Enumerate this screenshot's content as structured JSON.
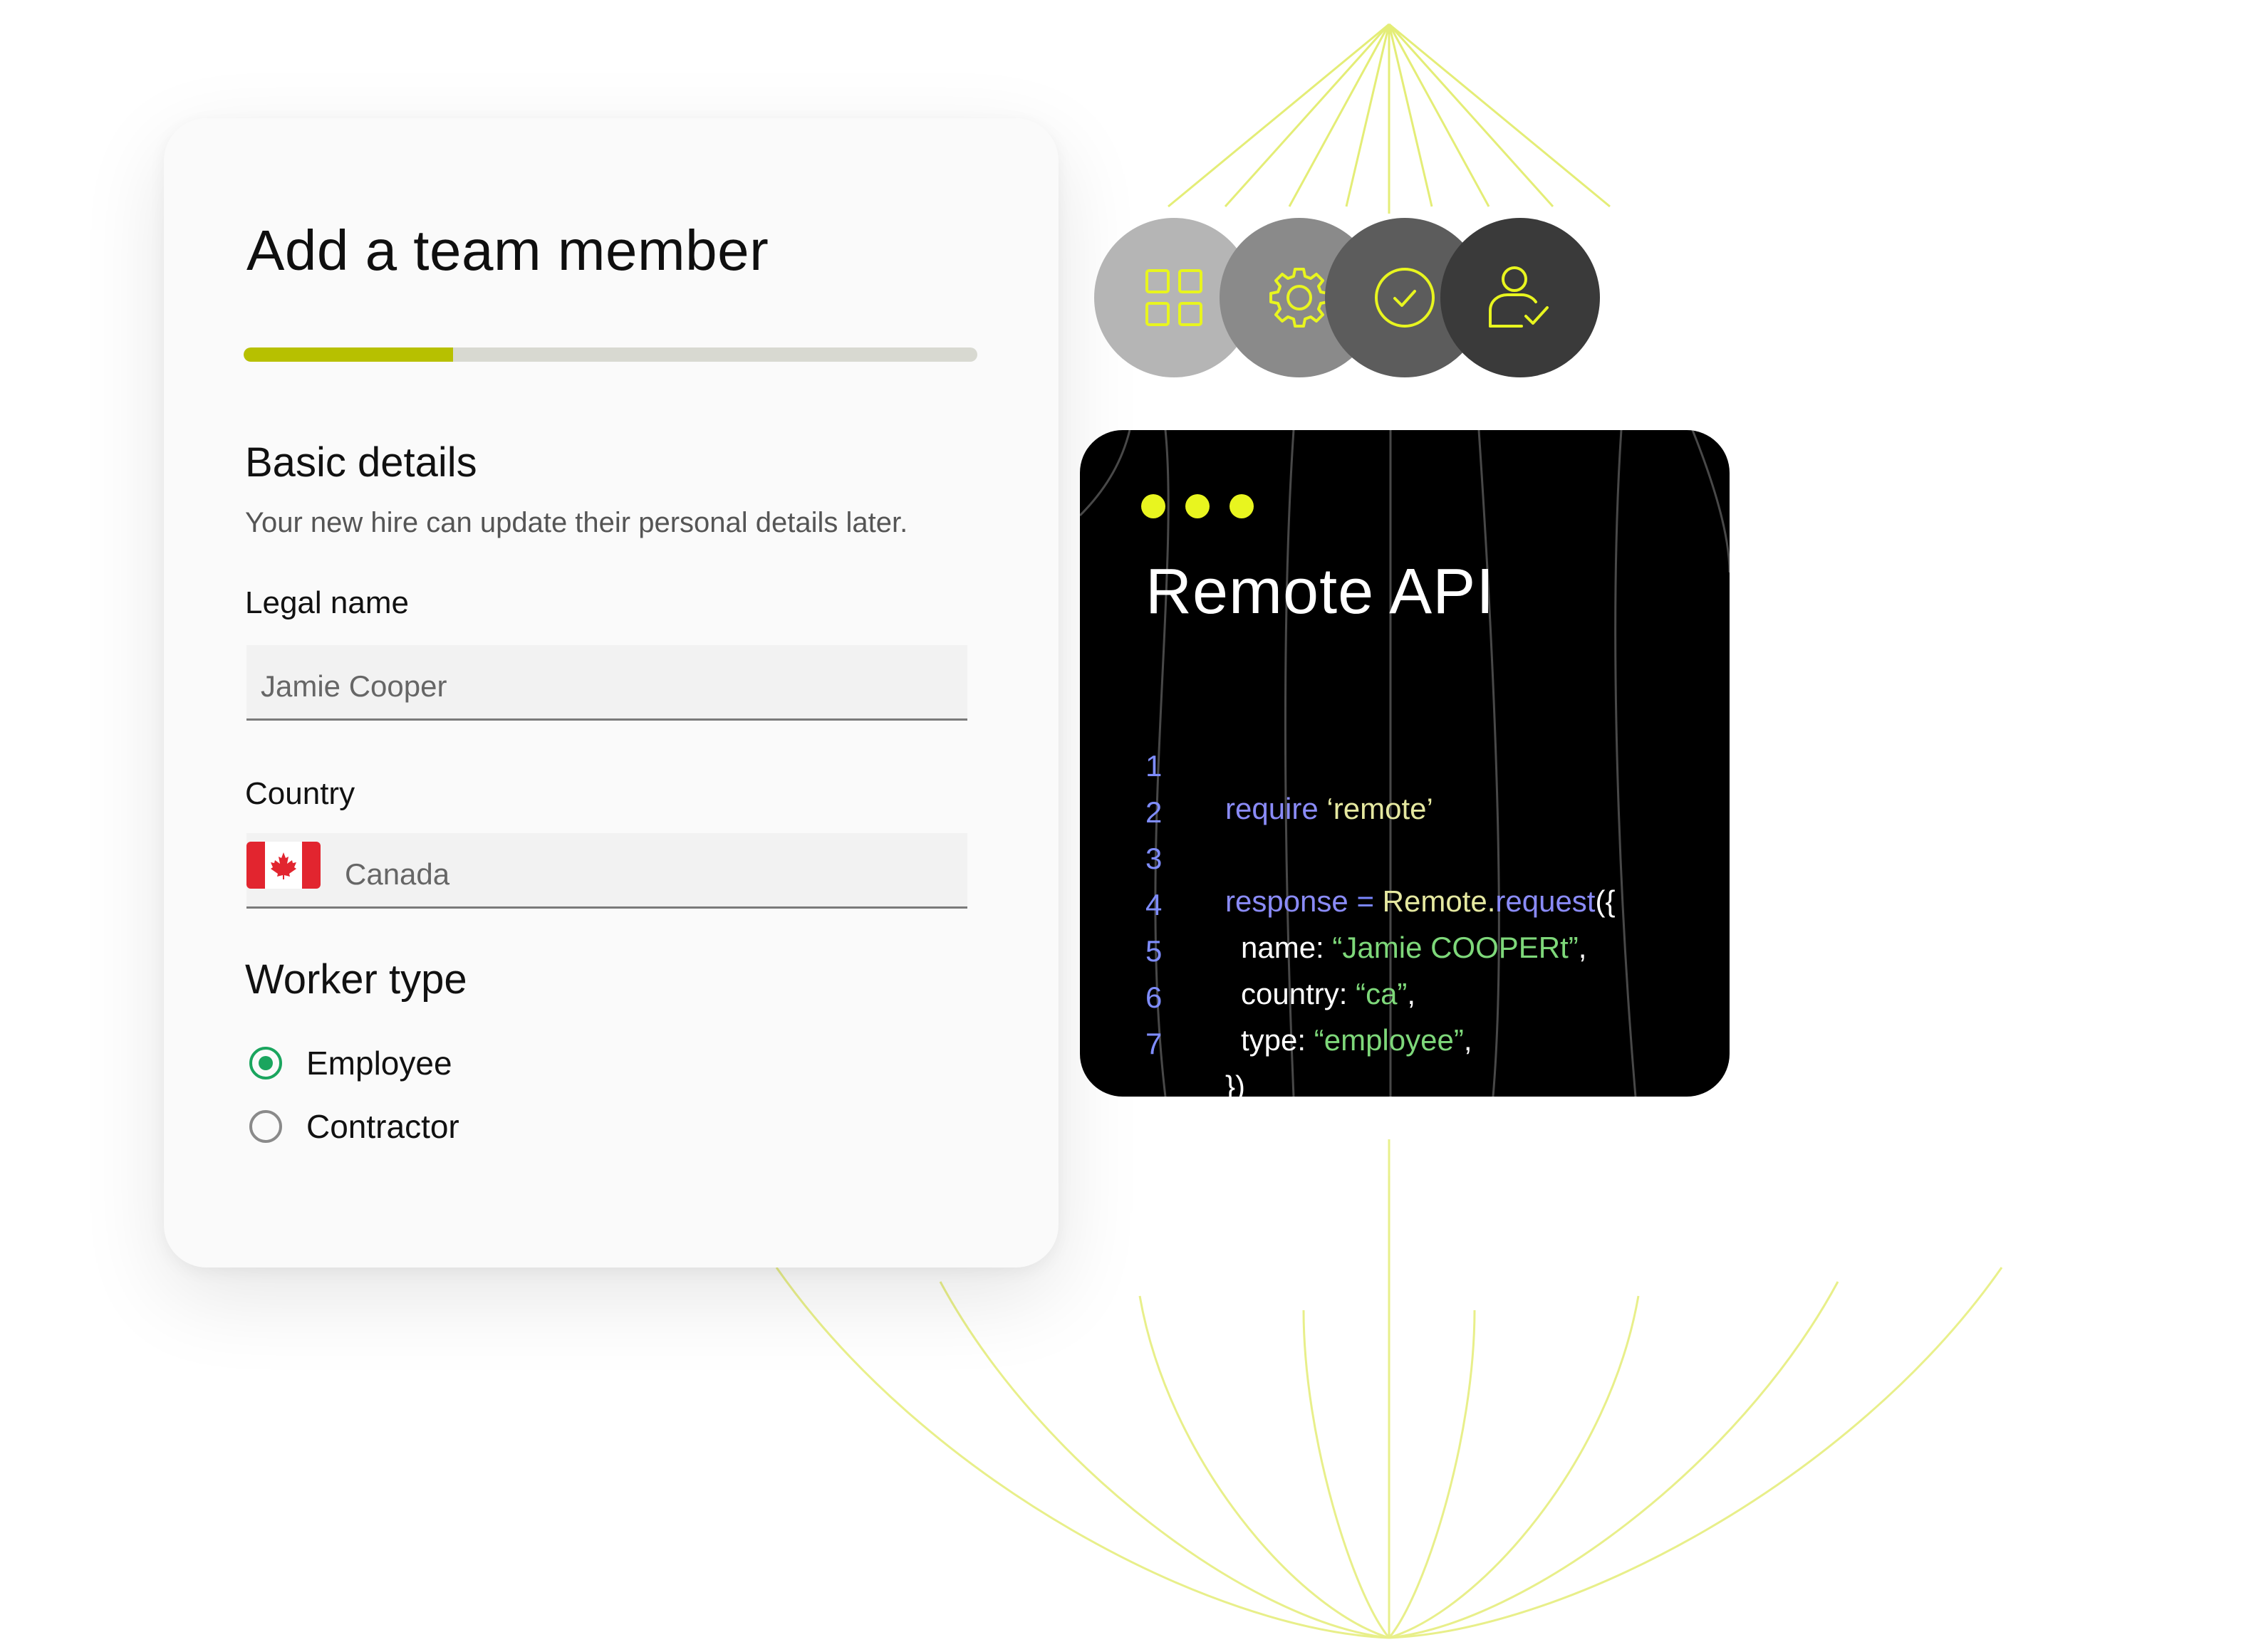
{
  "form": {
    "title": "Add a team member",
    "progress": 0.285,
    "section_heading": "Basic details",
    "section_subtitle": "Your new hire can update their personal details later.",
    "legal_name": {
      "label": "Legal  name",
      "value": "Jamie Cooper"
    },
    "country": {
      "label": "Country",
      "value": "Canada",
      "flag": "canada-flag"
    },
    "worker_type": {
      "heading": "Worker type",
      "options": [
        {
          "label": "Employee",
          "selected": true
        },
        {
          "label": "Contractor",
          "selected": false
        }
      ]
    }
  },
  "steps": [
    {
      "icon": "grid-icon",
      "color": "#b5b5b5"
    },
    {
      "icon": "gear-icon",
      "color": "#8a8a8a"
    },
    {
      "icon": "check-circle-icon",
      "color": "#5c5c5c"
    },
    {
      "icon": "user-check-icon",
      "color": "#3a3a3a"
    }
  ],
  "api": {
    "title": "Remote API",
    "line_numbers": [
      "1",
      "2",
      "3",
      "4",
      "5",
      "6",
      "7"
    ],
    "code": {
      "l1_kw": "require",
      "l1_str": "‘remote’",
      "l3_kw": "response",
      "l3_op": "=",
      "l3_obj": "Remote.",
      "l3_method": "request",
      "l3_end": "({",
      "l4_key": "name: ",
      "l4_val": "“Jamie COOPERt”",
      "l4_end": ",",
      "l5_key": "country: ",
      "l5_val": "“ca”",
      "l5_end": ",",
      "l6_key": "type: ",
      "l6_val": "“employee”",
      "l6_end": ",",
      "l7": "})"
    }
  },
  "colors": {
    "accent_lime": "#e8f51f",
    "progress_fill": "#b7c000",
    "radio_selected": "#1aa55e"
  }
}
